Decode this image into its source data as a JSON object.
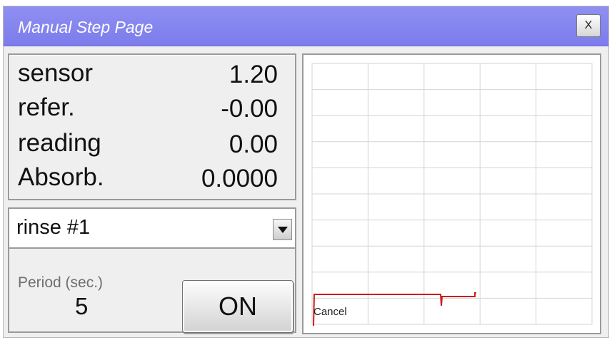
{
  "window": {
    "title": "Manual Step Page",
    "close_label": "X"
  },
  "readouts": [
    {
      "label": "sensor",
      "value": "1.20"
    },
    {
      "label": "refer.",
      "value": "-0.00"
    },
    {
      "label": "reading",
      "value": "0.00"
    },
    {
      "label": "Absorb.",
      "value": "0.0000"
    }
  ],
  "step_select": {
    "selected": "rinse #1"
  },
  "period": {
    "label": "Period (sec.)",
    "value": "5"
  },
  "toggle_button": {
    "label": "ON"
  },
  "chart": {
    "overlay_label": "Cancel",
    "trace_color": "#cc1e1e",
    "grid_color": "#d4d4d4",
    "grid_columns": 5,
    "grid_rows": 10
  }
}
